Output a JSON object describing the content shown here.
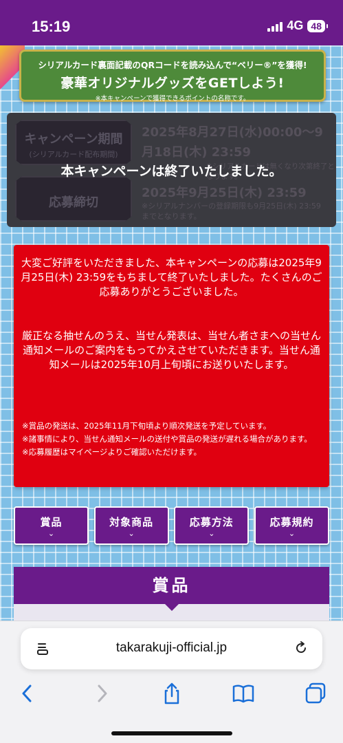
{
  "status": {
    "time": "15:19",
    "network": "4G",
    "battery": "48"
  },
  "banner": {
    "line1": "シリアルカード裏面記載のQRコードを読み込んで“ベリー®”を獲得!",
    "line2": "豪華オリジナルグッズをGETしよう!",
    "note": "※本キャンペーンで獲得できるポイントの名称です。"
  },
  "period": {
    "campaign_label": "キャンペーン期間",
    "campaign_sublabel": "(シリアルカード配布期間)",
    "campaign_dates": "2025年8月27日(水)00:00～9月18日(木) 23:59",
    "campaign_note": "※シリアルカードは無くなり次第終了となります。",
    "deadline_label": "応募締切",
    "deadline_date": "2025年9月25日(木) 23:59",
    "deadline_note": "※シリアルナンバーの登録期限も9月25日(木) 23:59までとなります。",
    "ended_message": "本キャンペーンは終了いたしました。"
  },
  "notice": {
    "paragraph1": "大変ご好評をいただきました、本キャンペーンの応募は2025年9月25日(木) 23:59をもちまして終了いたしました。たくさんのご応募ありがとうございました。",
    "paragraph2": "厳正なる抽せんのうえ、当せん発表は、当せん者さまへの当せん通知メールのご案内をもってかえさせていただきます。当せん通知メールは2025年10月上旬頃にお送りいたします。",
    "notes": [
      "※賞品の発送は、2025年11月下旬頃より順次発送を予定しています。",
      "※諸事情により、当せん通知メールの送付や賞品の発送が遅れる場合があります。",
      "※応募履歴はマイページよりご確認いただけます。"
    ]
  },
  "tabs": [
    {
      "label": "賞品"
    },
    {
      "label": "対象商品"
    },
    {
      "label": "応募方法"
    },
    {
      "label": "応募規約"
    }
  ],
  "section": {
    "title": "賞品"
  },
  "browser": {
    "url": "takarakuji-official.jp"
  },
  "colors": {
    "brand_purple": "#6a1b8a",
    "notice_red": "#e00010",
    "background_blue": "#7fbfe6"
  }
}
